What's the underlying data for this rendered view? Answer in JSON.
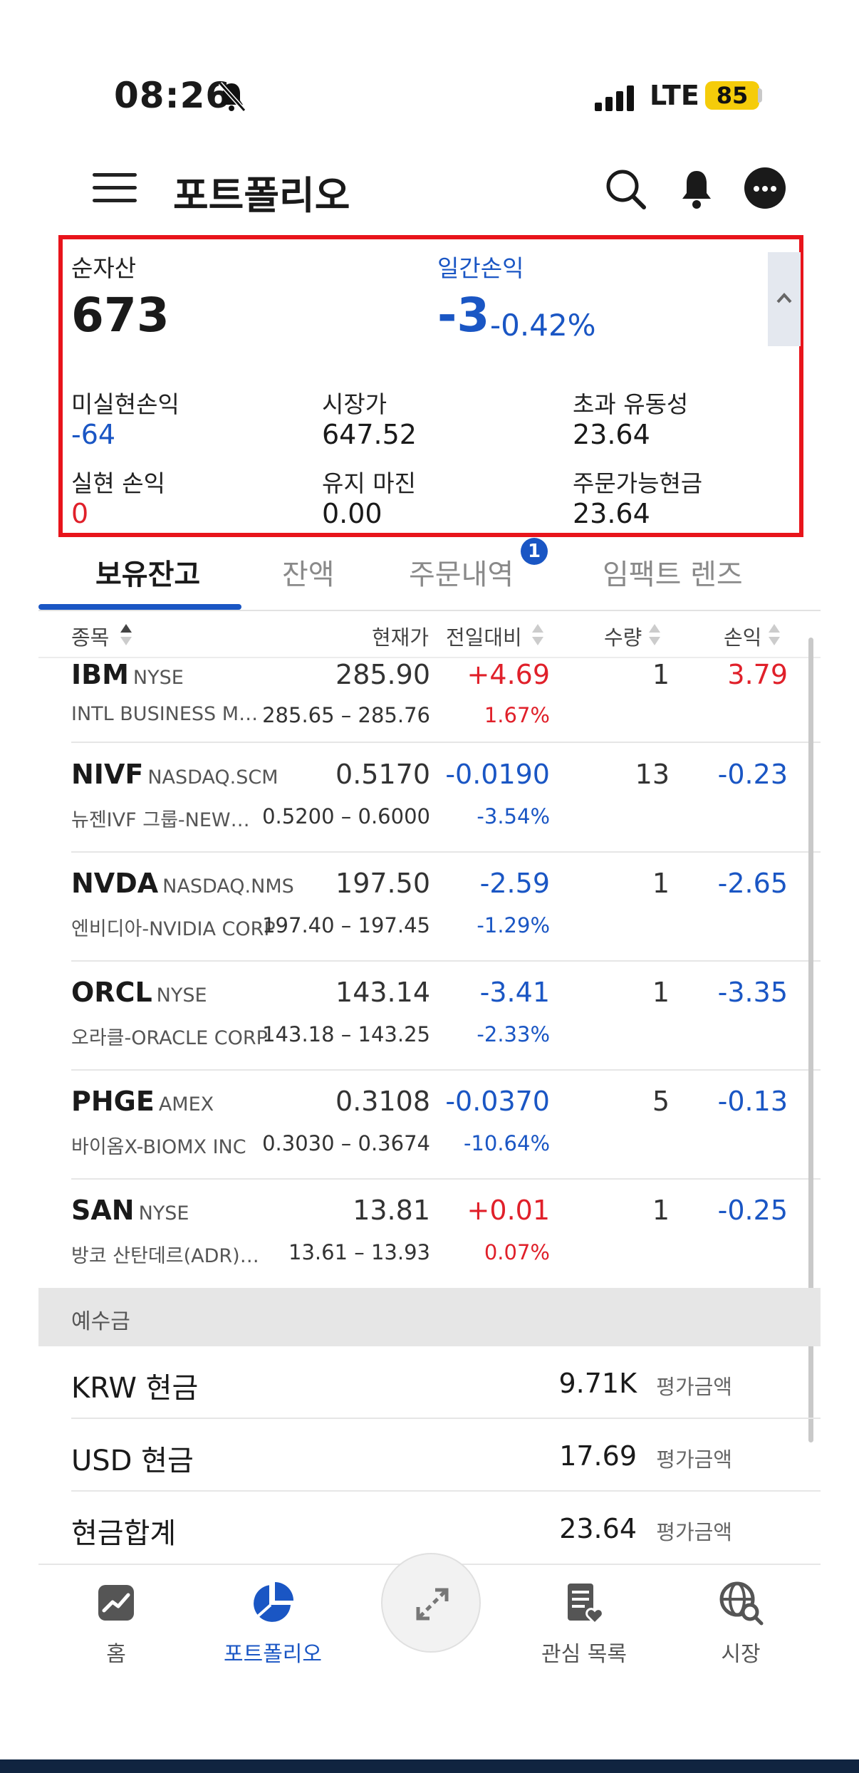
{
  "status_bar": {
    "time": "08:26",
    "network": "LTE",
    "battery": "85"
  },
  "header": {
    "title": "포트폴리오"
  },
  "summary": {
    "net_assets_label": "순자산",
    "net_assets_value": "673",
    "daily_pnl_label": "일간손익",
    "daily_pnl_value": "-3",
    "daily_pnl_pct": "-0.42%",
    "unrealized_label": "미실현손익",
    "unrealized_value": "-64",
    "market_value_label": "시장가",
    "market_value_value": "647.52",
    "excess_liquidity_label": "초과 유동성",
    "excess_liquidity_value": "23.64",
    "realized_label": "실현 손익",
    "realized_value": "0",
    "maint_margin_label": "유지 마진",
    "maint_margin_value": "0.00",
    "available_cash_label": "주문가능현금",
    "available_cash_value": "23.64"
  },
  "tabs": [
    {
      "label": "보유잔고",
      "active": true
    },
    {
      "label": "잔액"
    },
    {
      "label": "주문내역",
      "badge": "1"
    },
    {
      "label": "임팩트 렌즈"
    }
  ],
  "columns": {
    "symbol": "종목",
    "price": "현재가",
    "change": "전일대비",
    "qty": "수량",
    "pnl": "손익"
  },
  "positions": [
    {
      "symbol": "IBM",
      "exchange": "NYSE",
      "name": "INTL BUSINESS MACHIN…",
      "price": "285.90",
      "range": "285.65 – 285.76",
      "change": "+4.69",
      "change_pct": "1.67%",
      "qty": "1",
      "pnl": "3.79"
    },
    {
      "symbol": "NIVF",
      "exchange": "NASDAQ.SCM",
      "name": "뉴젠IVF 그룹-NEWGENIV…",
      "price": "0.5170",
      "range": "0.5200 – 0.6000",
      "change": "-0.0190",
      "change_pct": "-3.54%",
      "qty": "13",
      "pnl": "-0.23"
    },
    {
      "symbol": "NVDA",
      "exchange": "NASDAQ.NMS",
      "name": "엔비디아-NVIDIA CORP",
      "price": "197.50",
      "range": "197.40 – 197.45",
      "change": "-2.59",
      "change_pct": "-1.29%",
      "qty": "1",
      "pnl": "-2.65"
    },
    {
      "symbol": "ORCL",
      "exchange": "NYSE",
      "name": "오라클-ORACLE CORP",
      "price": "143.14",
      "range": "143.18 – 143.25",
      "change": "-3.41",
      "change_pct": "-2.33%",
      "qty": "1",
      "pnl": "-3.35"
    },
    {
      "symbol": "PHGE",
      "exchange": "AMEX",
      "name": "바이옴X-BIOMX INC",
      "price": "0.3108",
      "range": "0.3030 – 0.3674",
      "change": "-0.0370",
      "change_pct": "-10.64%",
      "qty": "5",
      "pnl": "-0.13"
    },
    {
      "symbol": "SAN",
      "exchange": "NYSE",
      "name": "방코 산탄데르(ADR)-BAN…",
      "price": "13.81",
      "range": "13.61 – 13.93",
      "change": "+0.01",
      "change_pct": "0.07%",
      "qty": "1",
      "pnl": "-0.25"
    }
  ],
  "deposits": {
    "header": "예수금",
    "rows": [
      {
        "label": "KRW 현금",
        "value": "9.71K",
        "tag": "평가금액"
      },
      {
        "label": "USD 현금",
        "value": "17.69",
        "tag": "평가금액"
      },
      {
        "label": "현금합계",
        "value": "23.64",
        "tag": "평가금액"
      }
    ]
  },
  "nav": [
    {
      "label": "홈"
    },
    {
      "label": "포트폴리오",
      "active": true
    },
    {
      "label": "관심 목록"
    },
    {
      "label": "시장"
    }
  ],
  "colors": {
    "accent": "#1a56c4",
    "negative": "#1a56c4",
    "positive": "#e0202a",
    "highlight_border": "#e8141b"
  }
}
